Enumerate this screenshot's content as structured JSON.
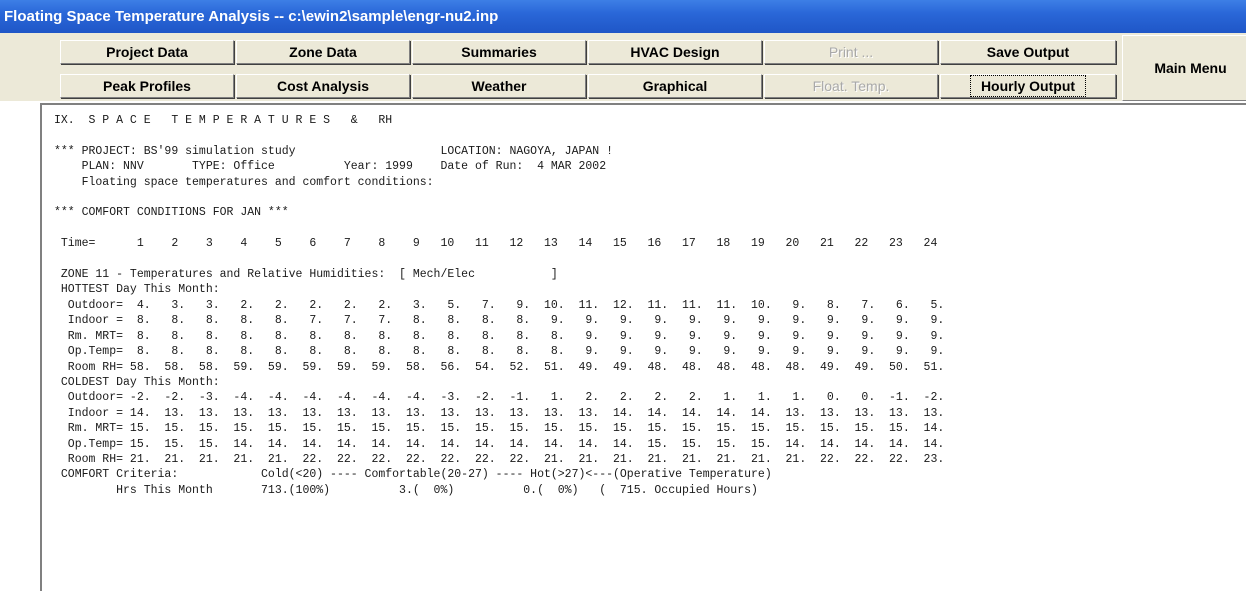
{
  "window": {
    "title": "Floating Space Temperature Analysis -- c:\\ewin2\\sample\\engr-nu2.inp"
  },
  "toolbar": {
    "row1": [
      "Project Data",
      "Zone Data",
      "Summaries",
      "HVAC Design",
      "Print ...",
      "Save Output"
    ],
    "row2": [
      "Peak Profiles",
      "Cost Analysis",
      "Weather",
      "Graphical",
      "Float. Temp.",
      "Hourly Output"
    ],
    "main_menu": "Main Menu",
    "disabled": [
      "Print ...",
      "Float. Temp."
    ],
    "focused": "Hourly Output"
  },
  "report": {
    "lines": [
      "IX.  S P A C E   T E M P E R A T U R E S   &   RH",
      "",
      "*** PROJECT: BS'99 simulation study                     LOCATION: NAGOYA, JAPAN !",
      "    PLAN: NNV       TYPE: Office          Year: 1999    Date of Run:  4 MAR 2002",
      "    Floating space temperatures and comfort conditions:",
      "",
      "*** COMFORT CONDITIONS FOR JAN ***",
      "",
      " Time=      1    2    3    4    5    6    7    8    9   10   11   12   13   14   15   16   17   18   19   20   21   22   23   24",
      "",
      " ZONE 11 - Temperatures and Relative Humidities:  [ Mech/Elec           ]",
      " HOTTEST Day This Month:",
      "  Outdoor=  4.   3.   3.   2.   2.   2.   2.   2.   3.   5.   7.   9.  10.  11.  12.  11.  11.  11.  10.   9.   8.   7.   6.   5.",
      "  Indoor =  8.   8.   8.   8.   8.   7.   7.   7.   8.   8.   8.   8.   9.   9.   9.   9.   9.   9.   9.   9.   9.   9.   9.   9.",
      "  Rm. MRT=  8.   8.   8.   8.   8.   8.   8.   8.   8.   8.   8.   8.   8.   9.   9.   9.   9.   9.   9.   9.   9.   9.   9.   9.",
      "  Op.Temp=  8.   8.   8.   8.   8.   8.   8.   8.   8.   8.   8.   8.   8.   9.   9.   9.   9.   9.   9.   9.   9.   9.   9.   9.",
      "  Room RH= 58.  58.  58.  59.  59.  59.  59.  59.  58.  56.  54.  52.  51.  49.  49.  48.  48.  48.  48.  48.  49.  49.  50.  51.",
      " COLDEST Day This Month:",
      "  Outdoor= -2.  -2.  -3.  -4.  -4.  -4.  -4.  -4.  -4.  -3.  -2.  -1.   1.   2.   2.   2.   2.   1.   1.   1.   0.   0.  -1.  -2.",
      "  Indoor = 14.  13.  13.  13.  13.  13.  13.  13.  13.  13.  13.  13.  13.  13.  14.  14.  14.  14.  14.  13.  13.  13.  13.  13.",
      "  Rm. MRT= 15.  15.  15.  15.  15.  15.  15.  15.  15.  15.  15.  15.  15.  15.  15.  15.  15.  15.  15.  15.  15.  15.  15.  14.",
      "  Op.Temp= 15.  15.  15.  14.  14.  14.  14.  14.  14.  14.  14.  14.  14.  14.  14.  15.  15.  15.  15.  14.  14.  14.  14.  14.",
      "  Room RH= 21.  21.  21.  21.  21.  22.  22.  22.  22.  22.  22.  22.  21.  21.  21.  21.  21.  21.  21.  21.  22.  22.  22.  23.",
      " COMFORT Criteria:            Cold(<20) ---- Comfortable(20-27) ---- Hot(>27)<---(Operative Temperature)",
      "         Hrs This Month       713.(100%)          3.(  0%)          0.(  0%)   (  715. Occupied Hours)"
    ]
  }
}
